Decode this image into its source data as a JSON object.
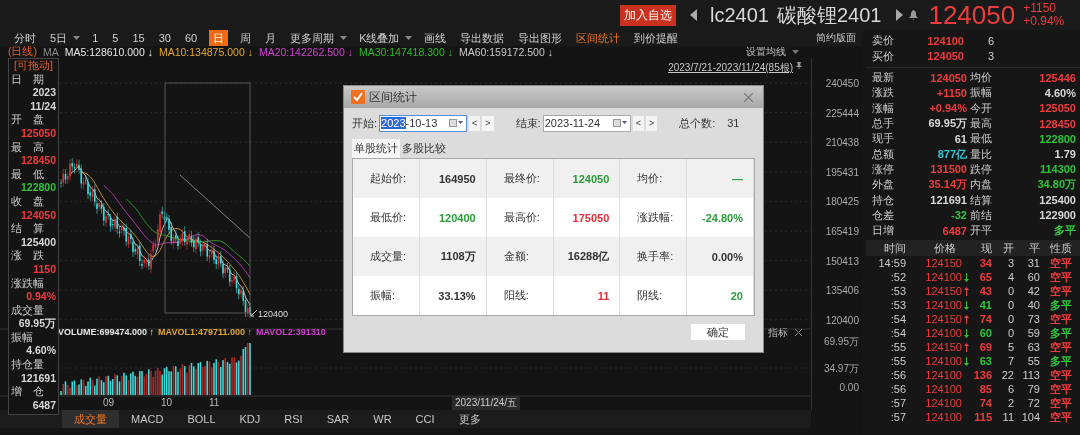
{
  "header": {
    "add_button": "加入自选",
    "symbol": "lc2401",
    "name": "碳酸锂2401",
    "price": "124050",
    "change": "+1150",
    "change_pct": "+0.94%"
  },
  "toolbar": [
    {
      "label": "分时",
      "selected": false,
      "active": false,
      "dropdown": false
    },
    {
      "label": "5日",
      "selected": false,
      "active": false,
      "dropdown": true
    },
    {
      "label": "1",
      "selected": false,
      "active": false,
      "dropdown": false
    },
    {
      "label": "5",
      "selected": false,
      "active": false,
      "dropdown": false
    },
    {
      "label": "15",
      "selected": false,
      "active": false,
      "dropdown": false
    },
    {
      "label": "30",
      "selected": false,
      "active": false,
      "dropdown": false
    },
    {
      "label": "60",
      "selected": false,
      "active": false,
      "dropdown": false
    },
    {
      "label": "日",
      "selected": true,
      "active": false,
      "dropdown": false
    },
    {
      "label": "周",
      "selected": false,
      "active": false,
      "dropdown": false
    },
    {
      "label": "月",
      "selected": false,
      "active": false,
      "dropdown": false
    },
    {
      "label": "更多周期",
      "selected": false,
      "active": false,
      "dropdown": true
    },
    {
      "label": "K线叠加",
      "selected": false,
      "active": false,
      "dropdown": true
    },
    {
      "label": "画线",
      "selected": false,
      "active": false,
      "dropdown": false
    },
    {
      "label": "导出数据",
      "selected": false,
      "active": false,
      "dropdown": false
    },
    {
      "label": "导出图形",
      "selected": false,
      "active": false,
      "dropdown": false
    },
    {
      "label": "区间统计",
      "selected": false,
      "active": true,
      "dropdown": false
    },
    {
      "label": "到价提醒",
      "selected": false,
      "active": false,
      "dropdown": false
    }
  ],
  "layout_button": "简约版面",
  "ma_line": {
    "period": "(日线)",
    "label": "MA",
    "settings": "设置均线",
    "items": [
      {
        "text": "MA5:128610.000 ↓",
        "color": "#e6e6e6"
      },
      {
        "text": "MA10:134875.000 ↓",
        "color": "#e0a838"
      },
      {
        "text": "MA20:142262.500 ↓",
        "color": "#d040d0"
      },
      {
        "text": "MA30:147418.300 ↓",
        "color": "#30b830"
      },
      {
        "text": "MA60:159172.500 ↓",
        "color": "#c8c8c8"
      }
    ]
  },
  "chart": {
    "range": "2023/7/21-2023/11/24(85根)",
    "low_marker": "120400",
    "price_ticks": [
      "240450",
      "225444",
      "210438",
      "195431",
      "180425",
      "165419",
      "150413",
      "135406",
      "120400"
    ],
    "volume_items": [
      {
        "text": "VOLUME:699474.000 ↑",
        "color": "#e6e6e6"
      },
      {
        "text": "MAVOL1:479711.000 ↑",
        "color": "#e0a838"
      },
      {
        "text": "MAVOL2:391310",
        "color": "#d040d0"
      }
    ],
    "indicator_button": "指标",
    "volume_ticks": [
      "69.95万",
      "34.97万",
      "0.00"
    ],
    "x_labels": [
      "09",
      "10",
      "11"
    ],
    "cursor_date": "2023/11/24/五"
  },
  "info_panel": {
    "title": "[可拖动]",
    "rows": [
      {
        "label": "日　期",
        "values": [
          "2023",
          "11/24"
        ],
        "color": "#d8d8d8"
      },
      {
        "label": "开　盘",
        "values": [
          "125050"
        ],
        "color": "#ee3b3b"
      },
      {
        "label": "最　高",
        "values": [
          "128450"
        ],
        "color": "#ee3b3b"
      },
      {
        "label": "最　低",
        "values": [
          "122800"
        ],
        "color": "#2fc43a"
      },
      {
        "label": "收　盘",
        "values": [
          "124050"
        ],
        "color": "#ee3b3b"
      },
      {
        "label": "结　算",
        "values": [
          "125400"
        ],
        "color": "#d8d8d8"
      },
      {
        "label": "涨　跌",
        "values": [
          "1150"
        ],
        "color": "#ee3b3b"
      },
      {
        "label": "涨跌幅",
        "values": [
          "0.94%"
        ],
        "color": "#ee3b3b"
      },
      {
        "label": "成交量",
        "values": [
          "69.95万"
        ],
        "color": "#d8d8d8"
      },
      {
        "label": "振幅",
        "values": [
          "4.60%"
        ],
        "color": "#d8d8d8"
      },
      {
        "label": "持仓量",
        "values": [
          "121691"
        ],
        "color": "#d8d8d8"
      },
      {
        "label": "增　仓",
        "values": [
          "6487"
        ],
        "color": "#d8d8d8"
      }
    ]
  },
  "indicator_tabs": [
    {
      "label": "成交量",
      "selected": true
    },
    {
      "label": "MACD",
      "selected": false
    },
    {
      "label": "BOLL",
      "selected": false
    },
    {
      "label": "KDJ",
      "selected": false
    },
    {
      "label": "RSI",
      "selected": false
    },
    {
      "label": "SAR",
      "selected": false
    },
    {
      "label": "WR",
      "selected": false
    },
    {
      "label": "CCI",
      "selected": false
    },
    {
      "label": "更多",
      "selected": false
    }
  ],
  "order_book": [
    {
      "label": "卖价",
      "price": "124100",
      "qty": "6",
      "color": "#ee3b3b"
    },
    {
      "label": "买价",
      "price": "124050",
      "qty": "3",
      "color": "#ee3b3b"
    }
  ],
  "stats": [
    {
      "label": "最新",
      "value": "124050",
      "color": "#ee3b3b"
    },
    {
      "label": "均价",
      "value": "125446",
      "color": "#ee3b3b"
    },
    {
      "label": "涨跌",
      "value": "+1150",
      "color": "#ee3b3b"
    },
    {
      "label": "振幅",
      "value": "4.60%",
      "color": "#d8d8d8"
    },
    {
      "label": "涨幅",
      "value": "+0.94%",
      "color": "#ee3b3b"
    },
    {
      "label": "今开",
      "value": "125050",
      "color": "#ee3b3b"
    },
    {
      "label": "总手",
      "value": "69.95万",
      "color": "#d8d8d8"
    },
    {
      "label": "最高",
      "value": "128450",
      "color": "#ee3b3b"
    },
    {
      "label": "现手",
      "value": "61",
      "color": "#d8d8d8"
    },
    {
      "label": "最低",
      "value": "122800",
      "color": "#2fc43a"
    },
    {
      "label": "总额",
      "value": "877亿",
      "color": "#38c6d6"
    },
    {
      "label": "量比",
      "value": "1.79",
      "color": "#d8d8d8"
    },
    {
      "label": "涨停",
      "value": "131500",
      "color": "#ee3b3b"
    },
    {
      "label": "跌停",
      "value": "114300",
      "color": "#2fc43a"
    },
    {
      "label": "外盘",
      "value": "35.14万",
      "color": "#ee3b3b"
    },
    {
      "label": "内盘",
      "value": "34.80万",
      "color": "#2fc43a"
    },
    {
      "label": "持仓",
      "value": "121691",
      "color": "#d8d8d8"
    },
    {
      "label": "结算",
      "value": "125400",
      "color": "#d8d8d8"
    },
    {
      "label": "仓差",
      "value": "-32",
      "color": "#2fc43a"
    },
    {
      "label": "前结",
      "value": "122900",
      "color": "#d8d8d8"
    },
    {
      "label": "日增",
      "value": "6487",
      "color": "#ee3b3b"
    },
    {
      "label": "开平",
      "value": "多平",
      "color": "#2fc43a"
    }
  ],
  "trades": {
    "columns": [
      "时间",
      "价格",
      "现",
      "开",
      "平",
      "性质"
    ],
    "rows": [
      {
        "kind": "plain",
        "time": "14:59",
        "price": "124150",
        "volume": {
          "text": "34",
          "color": "#ee3b3b"
        },
        "open": "3",
        "close": "31",
        "nature": {
          "text": "空平",
          "color": "#ee3b3b"
        }
      },
      {
        "kind": "down",
        "time": ":52",
        "price": "124100",
        "volume": {
          "text": "65",
          "color": "#ee3b3b"
        },
        "open": "4",
        "close": "60",
        "nature": {
          "text": "空平",
          "color": "#ee3b3b"
        }
      },
      {
        "kind": "up",
        "time": ":53",
        "price": "124150",
        "volume": {
          "text": "43",
          "color": "#ee3b3b"
        },
        "open": "0",
        "close": "42",
        "nature": {
          "text": "空平",
          "color": "#ee3b3b"
        }
      },
      {
        "kind": "down",
        "time": ":53",
        "price": "124100",
        "volume": {
          "text": "41",
          "color": "#2fc43a"
        },
        "open": "0",
        "close": "40",
        "nature": {
          "text": "多平",
          "color": "#2fc43a"
        }
      },
      {
        "kind": "up",
        "time": ":54",
        "price": "124150",
        "volume": {
          "text": "74",
          "color": "#ee3b3b"
        },
        "open": "0",
        "close": "73",
        "nature": {
          "text": "空平",
          "color": "#ee3b3b"
        }
      },
      {
        "kind": "down",
        "time": ":54",
        "price": "124100",
        "volume": {
          "text": "60",
          "color": "#2fc43a"
        },
        "open": "0",
        "close": "59",
        "nature": {
          "text": "多平",
          "color": "#2fc43a"
        }
      },
      {
        "kind": "up",
        "time": ":55",
        "price": "124150",
        "volume": {
          "text": "69",
          "color": "#ee3b3b"
        },
        "open": "5",
        "close": "63",
        "nature": {
          "text": "空平",
          "color": "#ee3b3b"
        }
      },
      {
        "kind": "down",
        "time": ":55",
        "price": "124100",
        "volume": {
          "text": "63",
          "color": "#2fc43a"
        },
        "open": "7",
        "close": "55",
        "nature": {
          "text": "多平",
          "color": "#2fc43a"
        }
      },
      {
        "kind": "plain",
        "time": ":56",
        "price": "124100",
        "volume": {
          "text": "136",
          "color": "#ee3b3b"
        },
        "open": "22",
        "close": "113",
        "nature": {
          "text": "空平",
          "color": "#ee3b3b"
        }
      },
      {
        "kind": "plain",
        "time": ":56",
        "price": "124100",
        "volume": {
          "text": "85",
          "color": "#ee3b3b"
        },
        "open": "6",
        "close": "79",
        "nature": {
          "text": "空平",
          "color": "#ee3b3b"
        }
      },
      {
        "kind": "plain",
        "time": ":57",
        "price": "124100",
        "volume": {
          "text": "74",
          "color": "#ee3b3b"
        },
        "open": "2",
        "close": "72",
        "nature": {
          "text": "空平",
          "color": "#ee3b3b"
        }
      },
      {
        "kind": "plain",
        "time": ":57",
        "price": "124100",
        "volume": {
          "text": "115",
          "color": "#ee3b3b"
        },
        "open": "11",
        "close": "104",
        "nature": {
          "text": "空平",
          "color": "#ee3b3b"
        }
      }
    ]
  },
  "dialog": {
    "title": "区间统计",
    "start_label": "开始:",
    "start_selected": "2023",
    "start_rest": "-10-13",
    "end_label": "结束:",
    "end_value": "2023-11-24",
    "prev": "<",
    "next": ">",
    "count_label": "总个数:",
    "count": "31",
    "tabs": [
      {
        "label": "单股统计",
        "selected": true
      },
      {
        "label": "多股比较",
        "selected": false
      }
    ],
    "rows": [
      [
        {
          "label": "起始价:",
          "value": "164950",
          "color": "#333333"
        },
        {
          "label": "最终价:",
          "value": "124050",
          "color": "#2a9a3a"
        },
        {
          "label": "均价:",
          "value": "—",
          "color": "#2a9a3a"
        }
      ],
      [
        {
          "label": "最低价:",
          "value": "120400",
          "color": "#2a9a3a"
        },
        {
          "label": "最高价:",
          "value": "175050",
          "color": "#e0303a"
        },
        {
          "label": "涨跌幅:",
          "value": "-24.80%",
          "color": "#2a9a3a"
        }
      ],
      [
        {
          "label": "成交量:",
          "value": "1108万",
          "color": "#333333"
        },
        {
          "label": "金额:",
          "value": "16288亿",
          "color": "#333333"
        },
        {
          "label": "换手率:",
          "value": "0.00%",
          "color": "#333333"
        }
      ],
      [
        {
          "label": "振幅:",
          "value": "33.13%",
          "color": "#333333"
        },
        {
          "label": "阳线:",
          "value": "11",
          "color": "#e0303a"
        },
        {
          "label": "阴线:",
          "value": "20",
          "color": "#2a9a3a"
        }
      ]
    ],
    "ok_button": "确定"
  }
}
